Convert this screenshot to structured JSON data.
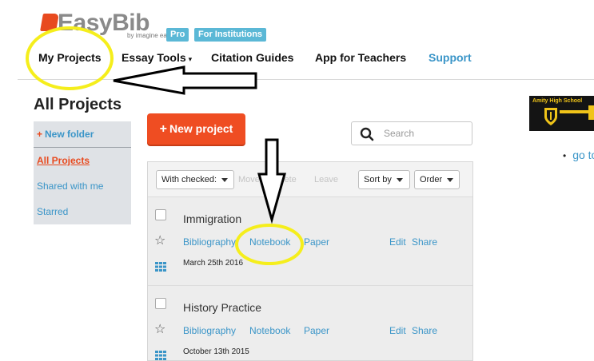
{
  "brand": {
    "name": "EasyBib",
    "sub": "by imagine easy",
    "badge_pro": "Pro",
    "badge_institutions": "For Institutions"
  },
  "nav": {
    "my_projects": "My Projects",
    "essay_tools": "Essay Tools",
    "citation_guides": "Citation Guides",
    "app_for_teachers": "App for Teachers",
    "support": "Support"
  },
  "page_title": "All Projects",
  "sidebar": {
    "new_folder": "New folder",
    "items": [
      {
        "label": "All Projects",
        "active": true
      },
      {
        "label": "Shared with me",
        "active": false
      },
      {
        "label": "Starred",
        "active": false
      }
    ]
  },
  "actions": {
    "new_project": "New project",
    "search_placeholder": "Search"
  },
  "toolbar": {
    "with_checked": "With checked:",
    "move": "Move",
    "delete": "Delete",
    "leave": "Leave",
    "sort_by": "Sort by",
    "order": "Order"
  },
  "projects": [
    {
      "title": "Immigration",
      "bibliography": "Bibliography",
      "notebook": "Notebook",
      "paper": "Paper",
      "edit": "Edit",
      "share": "Share",
      "date": "March 25th 2016"
    },
    {
      "title": "History Practice",
      "bibliography": "Bibliography",
      "notebook": "Notebook",
      "paper": "Paper",
      "edit": "Edit",
      "share": "Share",
      "date": "October 13th 2015"
    }
  ],
  "right": {
    "school_name": "Amity High School",
    "goto_link": "go to"
  },
  "colors": {
    "brand_orange": "#ef4d22",
    "link_blue": "#3a95c8",
    "badge_blue": "#5bb8d6",
    "highlight_yellow": "#f5ee1c"
  },
  "icons": [
    "search-icon",
    "star-icon",
    "grid-icon",
    "chevron-down-icon",
    "plus-icon",
    "school-crest-icon"
  ]
}
